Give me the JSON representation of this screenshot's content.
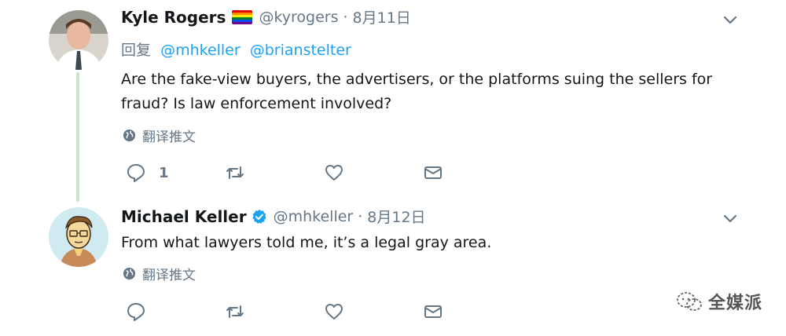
{
  "tweets": [
    {
      "name": "Kyle Rogers",
      "handle": "@kyrogers",
      "date": "8月11日",
      "reply_label": "回复",
      "reply_mentions": [
        "@mhkeller",
        "@brianstelter"
      ],
      "text": "Are the fake-view buyers, the advertisers, or the platforms suing the sellers for fraud? Is law enforcement involved?",
      "translate_label": "翻译推文",
      "reply_count": "1",
      "badge_icon": "rainbow-flag-icon"
    },
    {
      "name": "Michael Keller",
      "handle": "@mhkeller",
      "date": "8月12日",
      "text": "From what lawyers told me, it’s a legal gray area.",
      "translate_label": "翻译推文",
      "reply_count": "",
      "badge_icon": "verified-badge-icon"
    }
  ],
  "separator": "·",
  "watermark": "全媒派",
  "colors": {
    "link": "#1da1f2",
    "muted": "#657786",
    "thread_line": "#c4e6c4",
    "verified": "#1da1f2"
  }
}
